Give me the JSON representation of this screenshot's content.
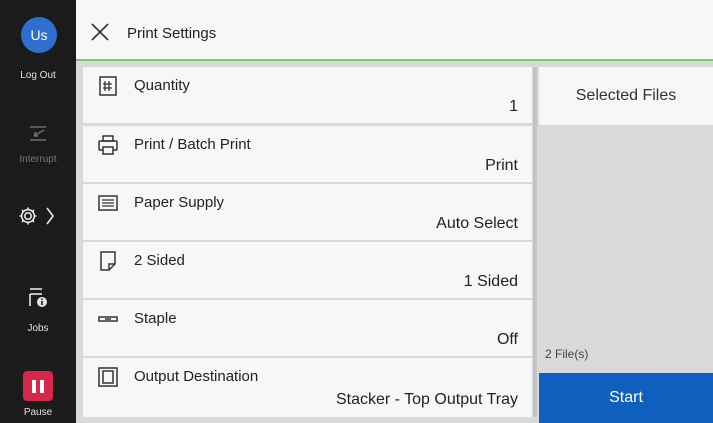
{
  "rail": {
    "avatar_text": "Us",
    "logout_label": "Log Out",
    "interrupt_label": "Interrupt",
    "jobs_label": "Jobs",
    "pause_label": "Pause"
  },
  "header": {
    "title": "Print Settings"
  },
  "settings": [
    {
      "label": "Quantity",
      "value": "1",
      "icon": "quantity-icon"
    },
    {
      "label": "Print / Batch Print",
      "value": "Print",
      "icon": "printer-icon"
    },
    {
      "label": "Paper Supply",
      "value": "Auto Select",
      "icon": "paper-tray-icon"
    },
    {
      "label": "2 Sided",
      "value": "1 Sided",
      "icon": "page-icon"
    },
    {
      "label": "Staple",
      "value": "Off",
      "icon": "staple-icon"
    },
    {
      "label": "Output Destination",
      "value": "Stacker - Top Output Tray",
      "icon": "output-tray-icon"
    }
  ],
  "panel": {
    "selected_files_label": "Selected Files",
    "file_count": "2 File(s)",
    "start_label": "Start"
  },
  "colors": {
    "accent_green": "#7bc96f",
    "start_blue": "#0f5fbf",
    "pause_red": "#d6264b",
    "avatar_blue": "#2f6fcf"
  }
}
